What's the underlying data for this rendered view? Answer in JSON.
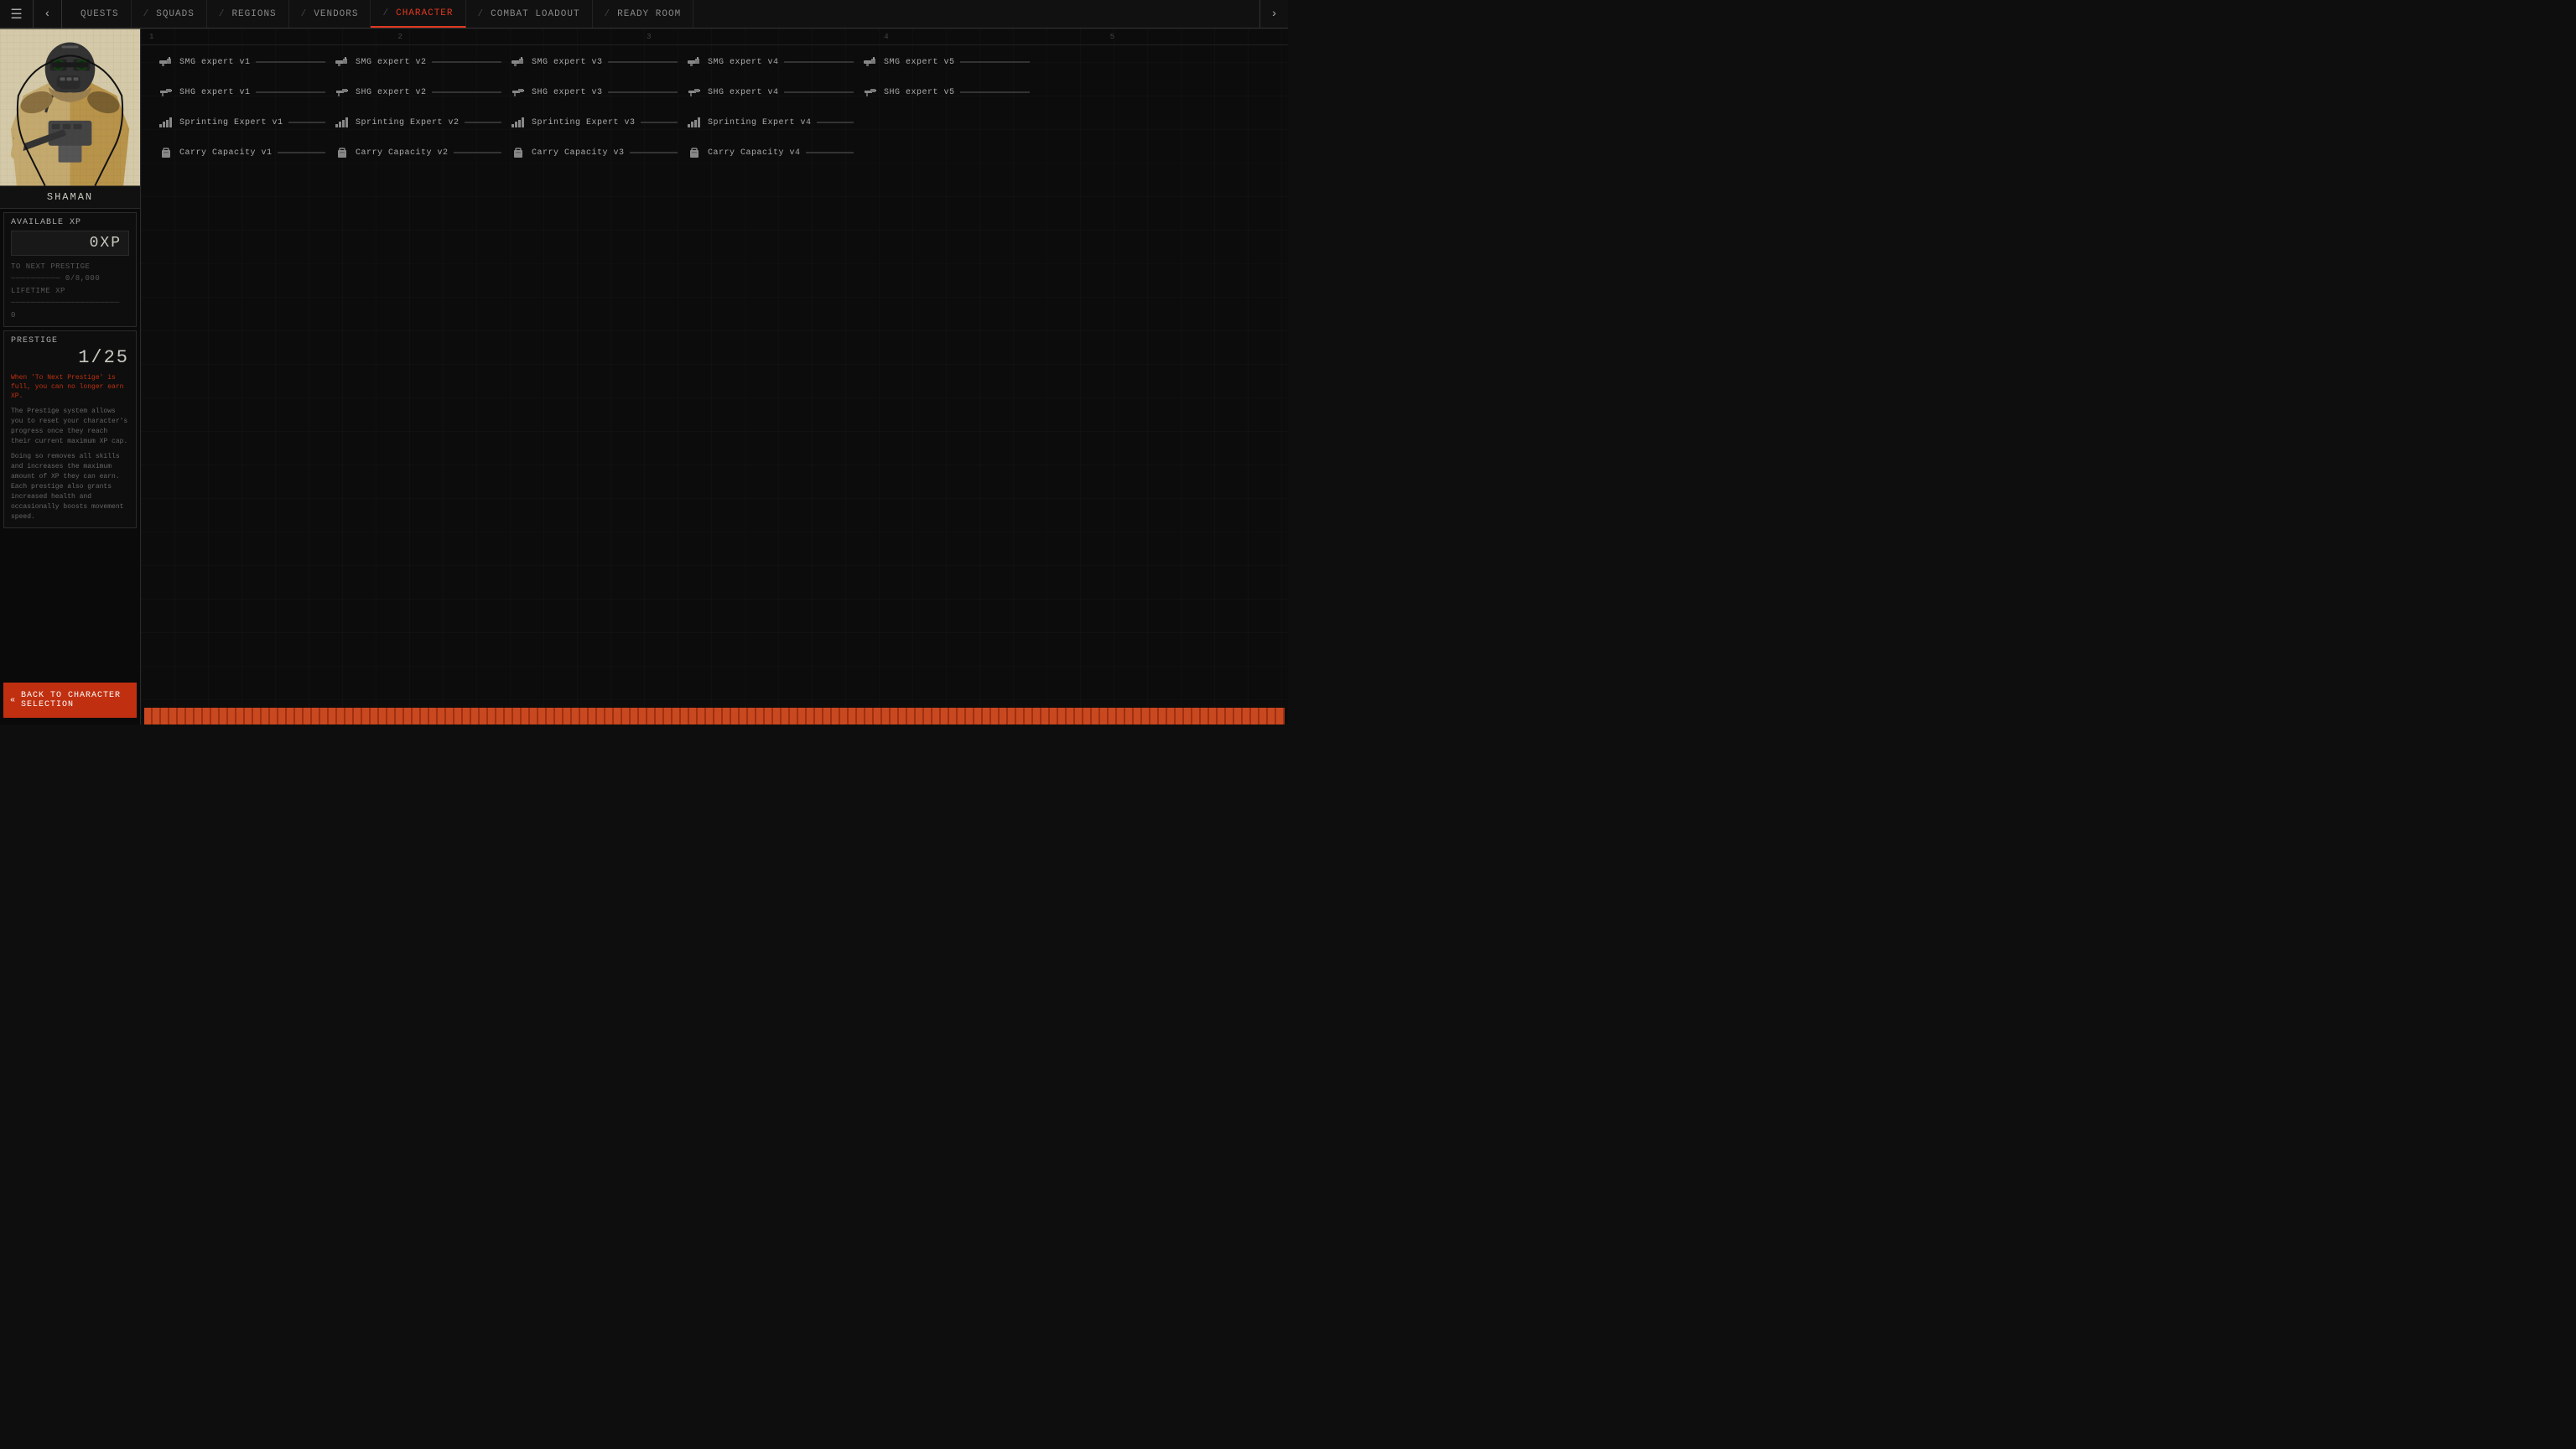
{
  "nav": {
    "items": [
      {
        "label": "QUESTS",
        "active": false
      },
      {
        "label": "SQUADS",
        "active": false
      },
      {
        "label": "REGIONS",
        "active": false
      },
      {
        "label": "VENDORS",
        "active": false
      },
      {
        "label": "CHARACTER",
        "active": true
      },
      {
        "label": "COMBAT LOADOUT",
        "active": false
      },
      {
        "label": "READY ROOM",
        "active": false
      }
    ]
  },
  "character": {
    "name": "SHAMAN"
  },
  "xp": {
    "section_title": "AVAILABLE XP",
    "value": "0XP",
    "to_next_prestige_label": "TO NEXT PRESTIGE",
    "to_next_prestige_value": "0/8,000",
    "lifetime_xp_label": "LIFETIME XP",
    "lifetime_xp_value": "0"
  },
  "prestige": {
    "title": "PRESTIGE",
    "value": "1/25",
    "warning": "When 'To Next Prestige' is full, you can no longer earn XP.",
    "desc1": "The Prestige system allows you to reset your character's progress once they reach their current maximum XP cap.",
    "desc2": "Doing so removes all skills and increases the maximum amount of XP they can earn. Each prestige also grants increased health and occasionally boosts movement speed."
  },
  "back_button": {
    "label": "BACK TO CHARACTER SELECTION",
    "arrow": "«"
  },
  "column_markers": [
    "1",
    "2",
    "3",
    "4",
    "5"
  ],
  "skills": {
    "rows": [
      {
        "items": [
          {
            "icon": "gun",
            "label": "SMG expert v1"
          },
          {
            "icon": "gun",
            "label": "SMG expert v2"
          },
          {
            "icon": "gun",
            "label": "SMG expert v3"
          },
          {
            "icon": "gun",
            "label": "SMG expert v4"
          },
          {
            "icon": "gun",
            "label": "SMG expert v5"
          }
        ]
      },
      {
        "items": [
          {
            "icon": "pistol",
            "label": "SHG expert v1"
          },
          {
            "icon": "pistol",
            "label": "SHG expert v2"
          },
          {
            "icon": "pistol",
            "label": "SHG expert v3"
          },
          {
            "icon": "pistol",
            "label": "SHG expert v4"
          },
          {
            "icon": "pistol",
            "label": "SHG expert v5"
          }
        ]
      },
      {
        "items": [
          {
            "icon": "bars",
            "label": "Sprinting Expert v1"
          },
          {
            "icon": "bars",
            "label": "Sprinting Expert v2"
          },
          {
            "icon": "bars",
            "label": "Sprinting Expert v3"
          },
          {
            "icon": "bars",
            "label": "Sprinting Expert v4"
          }
        ]
      },
      {
        "items": [
          {
            "icon": "bag",
            "label": "Carry Capacity v1"
          },
          {
            "icon": "bag",
            "label": "Carry Capacity v2"
          },
          {
            "icon": "bag",
            "label": "Carry Capacity v3"
          },
          {
            "icon": "bag",
            "label": "Carry Capacity v4"
          }
        ]
      }
    ]
  }
}
